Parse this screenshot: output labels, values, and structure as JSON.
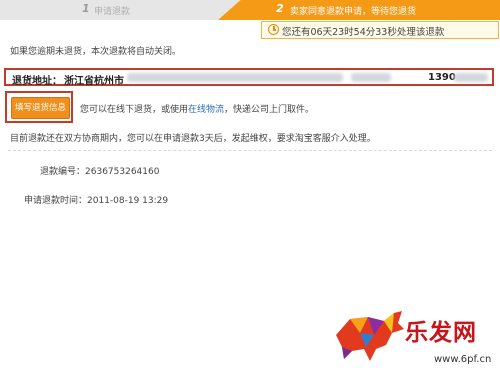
{
  "steps": [
    {
      "num": "1",
      "label": "申请退款"
    },
    {
      "num": "2",
      "label": "卖家同意退款申请，等待您退货"
    }
  ],
  "countdown": {
    "text": "您还有06天23时54分33秒处理该退款",
    "icon": "clock-icon"
  },
  "notice": "如果您逾期未退货，本次退款将自动关闭。",
  "address": {
    "label": "退货地址：",
    "city": "浙江省杭州市",
    "phone_visible": "1390"
  },
  "fill_button": {
    "label": "填写退货信息"
  },
  "button_desc": {
    "before": "您可以在线下退货，或使用",
    "link": "在线物流",
    "after": "，快递公司上门取件。"
  },
  "warning": "目前退款还在双方协商期内，您可以在申请退款3天后，发起维权，要求淘宝客服介入处理。",
  "refund_no": {
    "label": "退款编号：",
    "value": "2636753264160"
  },
  "apply_time": {
    "label": "申请退款时间：",
    "value": "2011-08-19 13:29"
  },
  "watermark": {
    "brand": "乐发网",
    "url": "www.6pf.cn"
  },
  "colors": {
    "accent": "#f59a17",
    "highlight_border": "#c23b2b",
    "link": "#2a6fb4"
  }
}
